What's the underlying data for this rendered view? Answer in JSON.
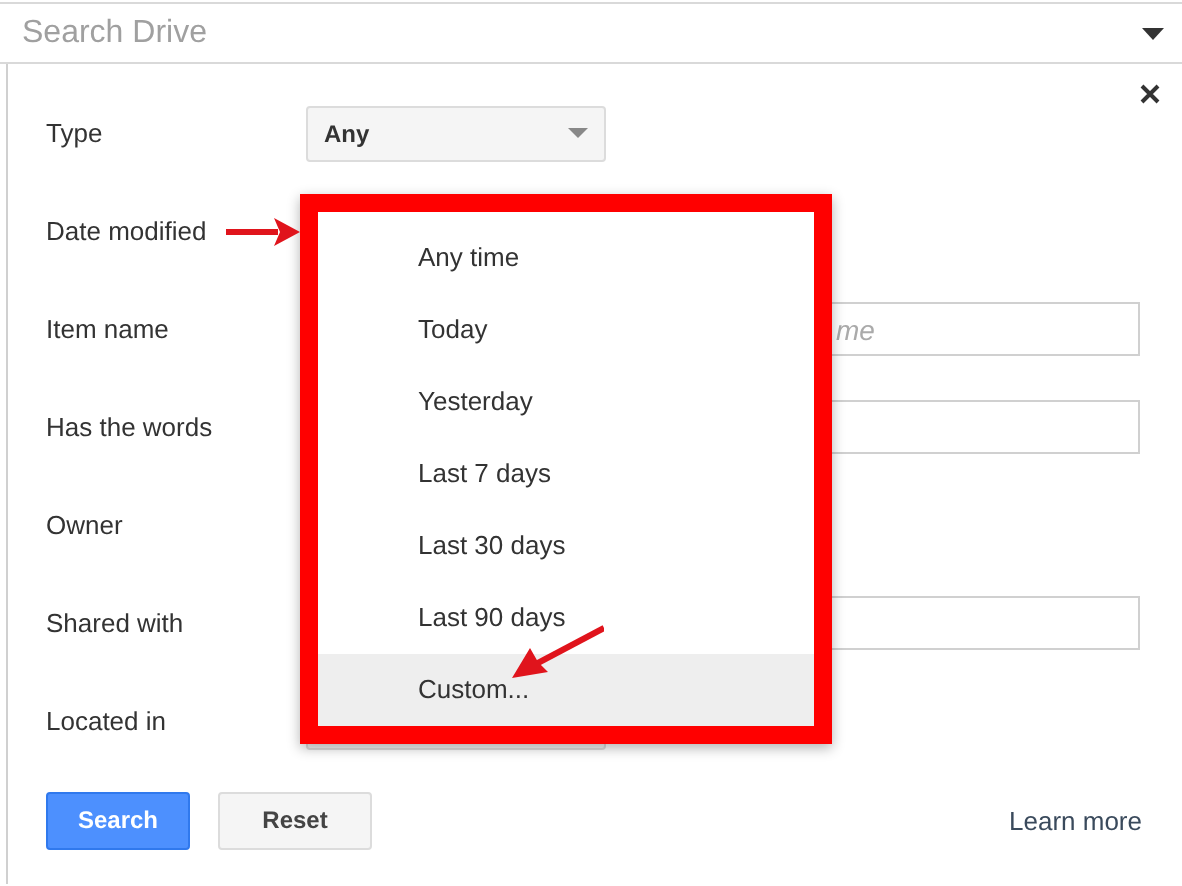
{
  "search": {
    "placeholder": "Search Drive"
  },
  "form": {
    "rows": [
      {
        "label": "Type",
        "kind": "select",
        "value": "Any"
      },
      {
        "label": "Date modified",
        "kind": "covered"
      },
      {
        "label": "Item name",
        "kind": "text",
        "placeholder": "me"
      },
      {
        "label": "Has the words",
        "kind": "text"
      },
      {
        "label": "Owner",
        "kind": "covered"
      },
      {
        "label": "Shared with",
        "kind": "text"
      },
      {
        "label": "Located in",
        "kind": "select"
      }
    ]
  },
  "dropdown": {
    "options": [
      {
        "label": "Any time",
        "selected": false
      },
      {
        "label": "Today",
        "selected": false
      },
      {
        "label": "Yesterday",
        "selected": false
      },
      {
        "label": "Last 7 days",
        "selected": false
      },
      {
        "label": "Last 30 days",
        "selected": false
      },
      {
        "label": "Last 90 days",
        "selected": false
      },
      {
        "label": "Custom...",
        "selected": true
      }
    ]
  },
  "buttons": [
    {
      "label": "Search",
      "kind": "primary"
    },
    {
      "label": "Reset",
      "kind": "secondary"
    }
  ],
  "learn_more": "Learn more"
}
